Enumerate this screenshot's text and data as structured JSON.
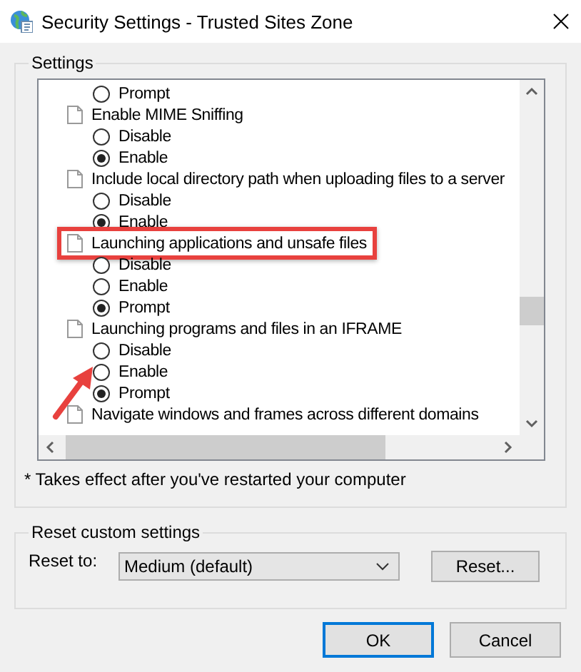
{
  "window": {
    "title": "Security Settings - Trusted Sites Zone"
  },
  "settings": {
    "label": "Settings",
    "items": [
      {
        "kind": "option",
        "label": "Prompt",
        "selected": false
      },
      {
        "kind": "setting",
        "label": "Enable MIME Sniffing",
        "highlighted": false,
        "options": [
          {
            "label": "Disable",
            "selected": false
          },
          {
            "label": "Enable",
            "selected": true
          }
        ]
      },
      {
        "kind": "setting",
        "label": "Include local directory path when uploading files to a server",
        "highlighted": false,
        "options": [
          {
            "label": "Disable",
            "selected": false
          },
          {
            "label": "Enable",
            "selected": true
          }
        ]
      },
      {
        "kind": "setting",
        "label": "Launching applications and unsafe files",
        "highlighted": true,
        "options": [
          {
            "label": "Disable",
            "selected": false
          },
          {
            "label": "Enable",
            "selected": false
          },
          {
            "label": "Prompt",
            "selected": true
          }
        ]
      },
      {
        "kind": "setting",
        "label": "Launching programs and files in an IFRAME",
        "highlighted": false,
        "options": [
          {
            "label": "Disable",
            "selected": false
          },
          {
            "label": "Enable",
            "selected": false
          },
          {
            "label": "Prompt",
            "selected": true
          }
        ]
      },
      {
        "kind": "setting",
        "label": "Navigate windows and frames across different domains",
        "highlighted": false
      }
    ],
    "footnote": "* Takes effect after you've restarted your computer"
  },
  "reset": {
    "label": "Reset custom settings",
    "field_label": "Reset to:",
    "value": "Medium (default)",
    "button": "Reset..."
  },
  "buttons": [
    {
      "label": "OK",
      "default": true
    },
    {
      "label": "Cancel",
      "default": false
    }
  ]
}
